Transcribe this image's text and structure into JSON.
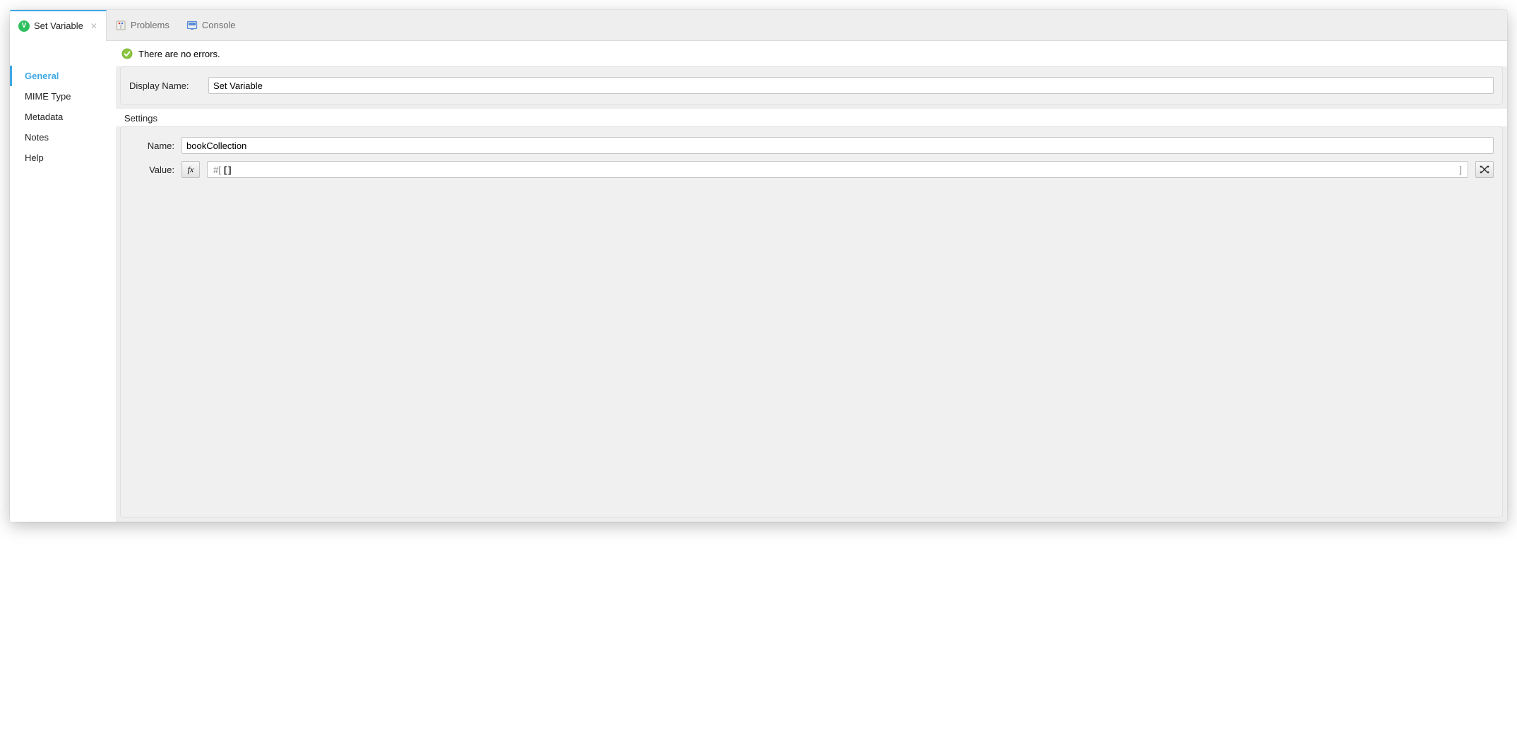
{
  "tabs": {
    "active": {
      "label": "Set Variable"
    },
    "problems": {
      "label": "Problems"
    },
    "console": {
      "label": "Console"
    }
  },
  "sidebar": {
    "items": [
      {
        "label": "General",
        "active": true
      },
      {
        "label": "MIME Type",
        "active": false
      },
      {
        "label": "Metadata",
        "active": false
      },
      {
        "label": "Notes",
        "active": false
      },
      {
        "label": "Help",
        "active": false
      }
    ]
  },
  "status": {
    "message": "There are no errors."
  },
  "display_name": {
    "label": "Display Name:",
    "value": "Set Variable"
  },
  "settings_label": "Settings",
  "settings": {
    "name": {
      "label": "Name:",
      "value": "bookCollection"
    },
    "value_row": {
      "label": "Value:",
      "expr_lead": "#[",
      "expr_mid": "[]",
      "expr_tail": "]",
      "fx_label": "fx"
    }
  }
}
